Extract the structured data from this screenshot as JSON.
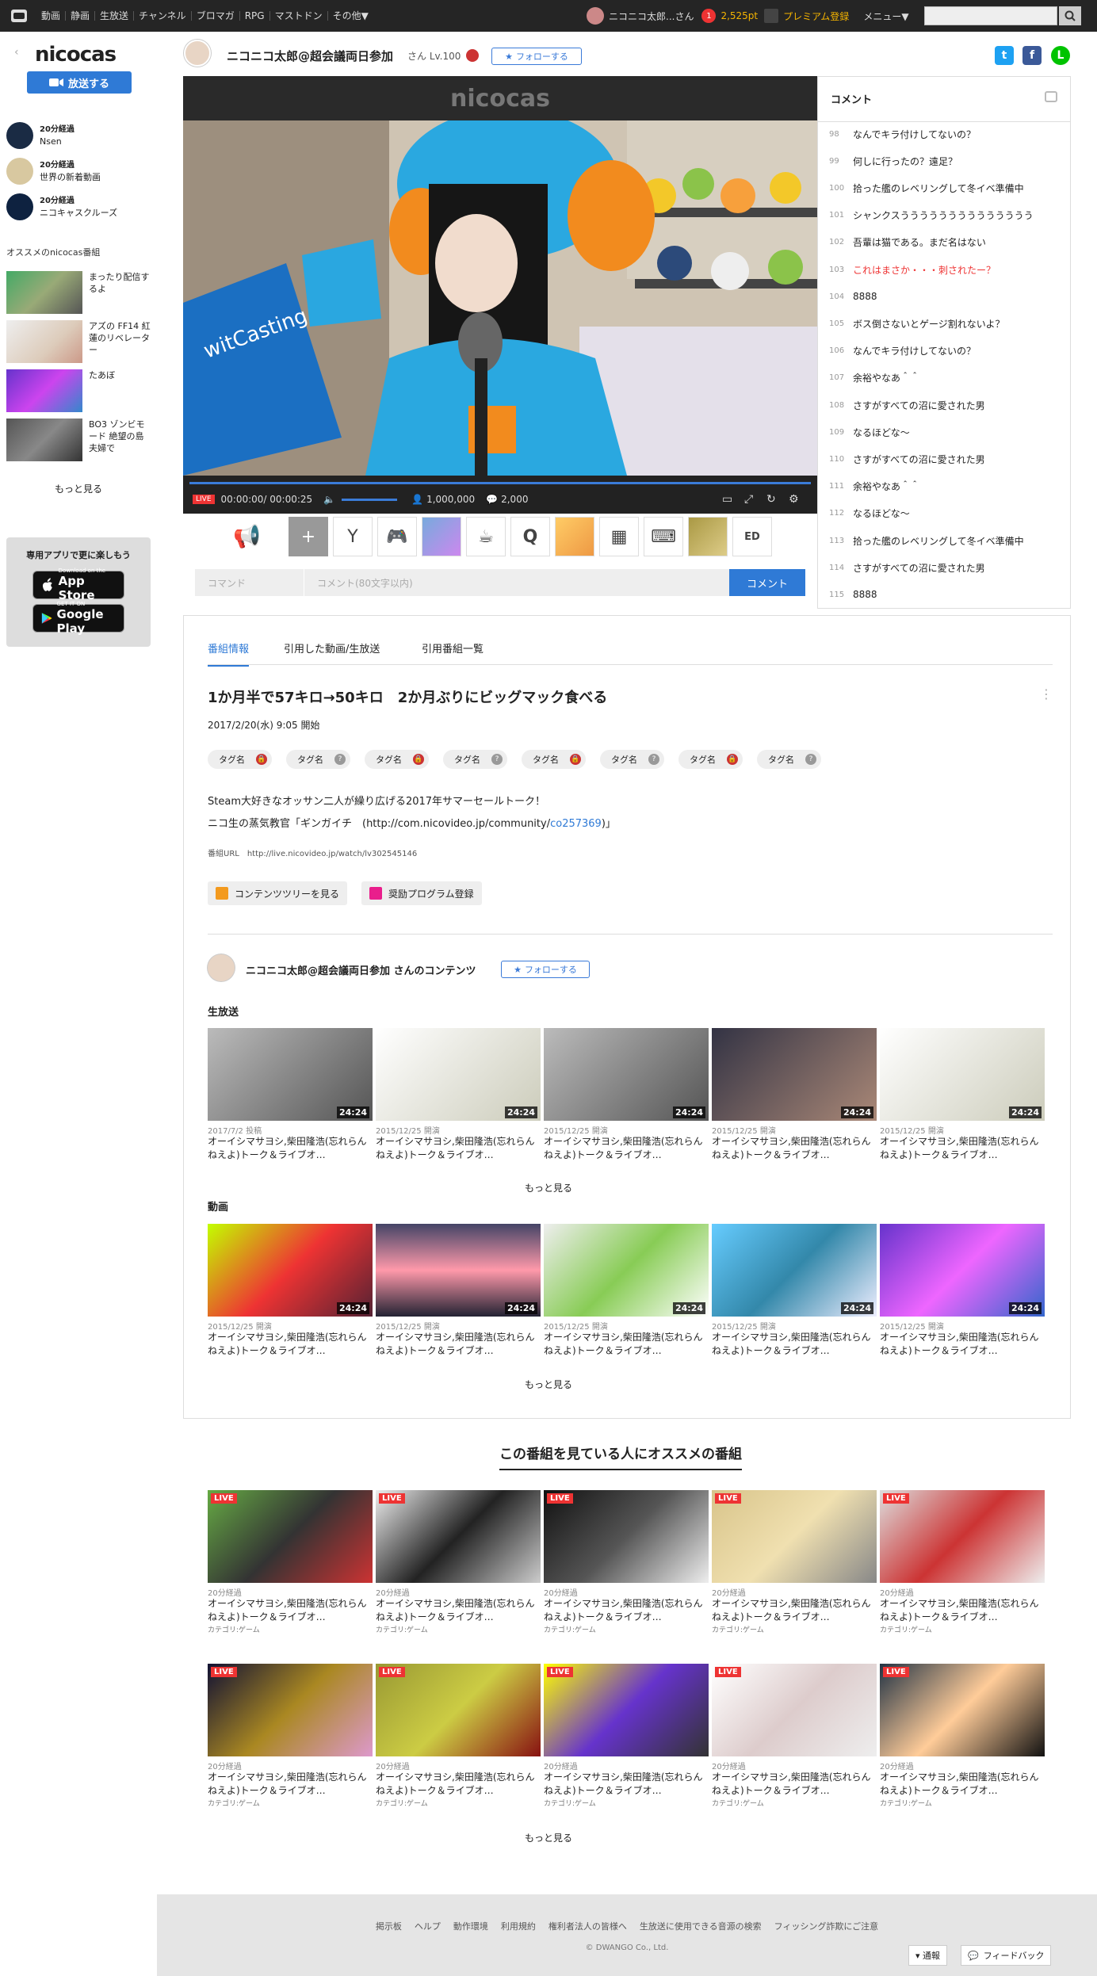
{
  "topbar": {
    "nav": [
      "動画",
      "静画",
      "生放送",
      "チャンネル",
      "ブロマガ",
      "RPG",
      "マストドン",
      "その他▼"
    ],
    "user_name": "ニコニコ太郎...さん",
    "notif_count": "1",
    "points": "2,525pt",
    "premium": "プレミアム登録",
    "menu": "メニュー▼",
    "search_placeholder": ""
  },
  "sidebar": {
    "logo": "nicocas",
    "broadcast_btn": "放送する",
    "channels": [
      {
        "time": "20分経過",
        "name": "Nsen"
      },
      {
        "time": "20分経過",
        "name": "世界の新着動画"
      },
      {
        "time": "20分経過",
        "name": "ニコキャスクルーズ"
      }
    ],
    "rec_heading": "オススメのnicocas番組",
    "recs": [
      "まったり配信するよ",
      "アズの FF14 紅蓮のリベレーター",
      "たあぼ",
      "BO3 ゾンビモード 絶望の島 夫婦で"
    ],
    "more": "もっと見る",
    "app_title": "専用アプリで更に楽しもう",
    "appstore_small": "Download on the",
    "appstore_big": "App Store",
    "gplay_small": "GET IT ON",
    "gplay_big": "Google Play"
  },
  "header": {
    "host_name": "ニコニコ太郎@超会議両日参加",
    "host_suffix": "さん Lv.100",
    "follow": "フォローする"
  },
  "player": {
    "logo": "nicocas",
    "live": "LIVE",
    "time": "00:00:00/ 00:00:25",
    "viewers": "1,000,000",
    "comments": "2,000",
    "command_placeholder": "コマンド",
    "comment_placeholder": "コメント(80文字以内)",
    "comment_button": "コメント"
  },
  "comments": {
    "title": "コメント",
    "rows": [
      {
        "no": "98",
        "text": "なんでキラ付けしてないの？"
      },
      {
        "no": "99",
        "text": "何しに行ったの？遠足？"
      },
      {
        "no": "100",
        "text": "拾った艦のレベリングして冬イベ準備中"
      },
      {
        "no": "101",
        "text": "シャンクスうううううううううううううう"
      },
      {
        "no": "102",
        "text": "吾輩は猫である。まだ名はない"
      },
      {
        "no": "103",
        "text": "これはまさか・・・刺されたー？"
      },
      {
        "no": "104",
        "text": "8888"
      },
      {
        "no": "105",
        "text": "ボス倒さないとゲージ割れないよ？"
      },
      {
        "no": "106",
        "text": "なんでキラ付けしてないの？"
      },
      {
        "no": "107",
        "text": "余裕やなあ＾＾"
      },
      {
        "no": "108",
        "text": "さすがすべての沼に愛された男"
      },
      {
        "no": "109",
        "text": "なるほどな～"
      },
      {
        "no": "110",
        "text": "さすがすべての沼に愛された男"
      },
      {
        "no": "111",
        "text": "余裕やなあ＾＾"
      },
      {
        "no": "112",
        "text": "なるほどな～"
      },
      {
        "no": "113",
        "text": "拾った艦のレベリングして冬イベ準備中"
      },
      {
        "no": "114",
        "text": "さすがすべての沼に愛された男"
      },
      {
        "no": "115",
        "text": "8888"
      }
    ]
  },
  "info": {
    "tabs": [
      "番組情報",
      "引用した動画/生放送",
      "引用番組一覧"
    ],
    "title": "1か月半で57キロ→50キロ　2か月ぶりにビッグマック食べる",
    "date": "2017/2/20(水) 9:05 開始",
    "tag": "タグ名",
    "desc1": "Steam大好きなオッサン二人が繰り広げる2017年サマーセールトーク！",
    "desc2a": "ニコ生の蒸気教官「ギンガイチ　(http://com.nicovideo.jp/community/",
    "desc2link": "co257369",
    "desc2b": ")」",
    "url": "番組URL　http://live.nicovideo.jp/watch/lv302545146",
    "btn_tree": "コンテンツツリーを見る",
    "btn_prog": "奨励プログラム登録",
    "contents_title": "ニコニコ太郎@超会議両日参加 さんのコンテンツ",
    "sec_live": "生放送",
    "sec_video": "動画",
    "more": "もっと見る",
    "live_cards": [
      {
        "meta": "2017/7/2 投稿",
        "title": "オーイシマサヨシ,柴田隆浩(忘れらんねえよ)トーク＆ライブオ…",
        "dur": "24:24"
      },
      {
        "meta": "2015/12/25 開演",
        "title": "オーイシマサヨシ,柴田隆浩(忘れらんねえよ)トーク＆ライブオ…",
        "dur": "24:24"
      },
      {
        "meta": "2015/12/25 開演",
        "title": "オーイシマサヨシ,柴田隆浩(忘れらんねえよ)トーク＆ライブオ…",
        "dur": "24:24"
      },
      {
        "meta": "2015/12/25 開演",
        "title": "オーイシマサヨシ,柴田隆浩(忘れらんねえよ)トーク＆ライブオ…",
        "dur": "24:24"
      },
      {
        "meta": "2015/12/25 開演",
        "title": "オーイシマサヨシ,柴田隆浩(忘れらんねえよ)トーク＆ライブオ…",
        "dur": "24:24"
      }
    ],
    "video_cards": [
      {
        "meta": "2015/12/25 開演",
        "title": "オーイシマサヨシ,柴田隆浩(忘れらんねえよ)トーク＆ライブオ…",
        "dur": "24:24"
      },
      {
        "meta": "2015/12/25 開演",
        "title": "オーイシマサヨシ,柴田隆浩(忘れらんねえよ)トーク＆ライブオ…",
        "dur": "24:24"
      },
      {
        "meta": "2015/12/25 開演",
        "title": "オーイシマサヨシ,柴田隆浩(忘れらんねえよ)トーク＆ライブオ…",
        "dur": "24:24"
      },
      {
        "meta": "2015/12/25 開演",
        "title": "オーイシマサヨシ,柴田隆浩(忘れらんねえよ)トーク＆ライブオ…",
        "dur": "24:24"
      },
      {
        "meta": "2015/12/25 開演",
        "title": "オーイシマサヨシ,柴田隆浩(忘れらんねえよ)トーク＆ライブオ…",
        "dur": "24:24"
      }
    ]
  },
  "recommend": {
    "title": "この番組を見ている人にオススメの番組",
    "live": "LIVE",
    "time": "20分経過",
    "title_text": "オーイシマサヨシ,柴田隆浩(忘れらんねえよ)トーク＆ライブオ…",
    "category": "カテゴリ:ゲーム",
    "more": "もっと見る"
  },
  "footer": {
    "links": [
      "掲示板",
      "ヘルプ",
      "動作環境",
      "利用規約",
      "権利者法人の皆様へ",
      "生放送に使用できる音源の検索",
      "フィッシング詐欺にご注意"
    ],
    "copyright": "© DWANGO Co., Ltd.",
    "report": "▾ 通報",
    "feedback": "フィードバック"
  },
  "colors": {
    "accent": "#2f7ad6",
    "live": "#e33333",
    "topbar": "#252525"
  }
}
